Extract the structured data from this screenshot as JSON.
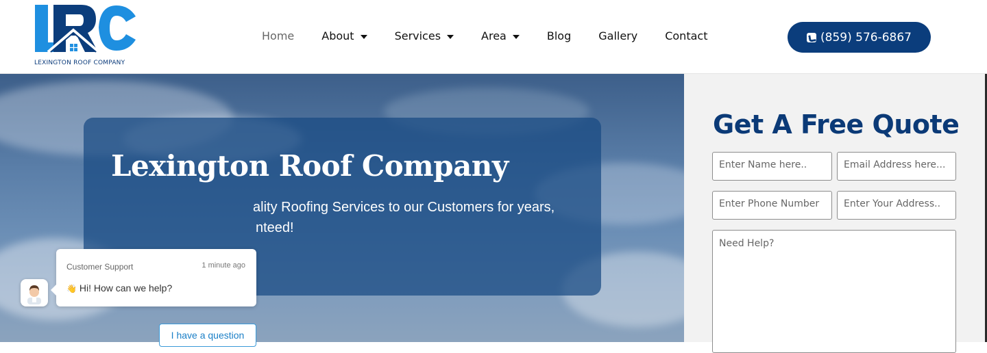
{
  "header": {
    "logo_letters": "LRC",
    "logo_tagline": "LEXINGTON ROOF COMPANY",
    "phone": "(859) 576-6867"
  },
  "nav": {
    "items": [
      {
        "label": "Home",
        "active": true,
        "dropdown": false
      },
      {
        "label": "About",
        "active": false,
        "dropdown": true
      },
      {
        "label": "Services",
        "active": false,
        "dropdown": true
      },
      {
        "label": "Area",
        "active": false,
        "dropdown": true
      },
      {
        "label": "Blog",
        "active": false,
        "dropdown": false
      },
      {
        "label": "Gallery",
        "active": false,
        "dropdown": false
      },
      {
        "label": "Contact",
        "active": false,
        "dropdown": false
      }
    ]
  },
  "hero": {
    "title": "Lexington Roof Company",
    "subtitle": "ality Roofing Services to our Customers for years,",
    "subtitle_line2": "nteed!"
  },
  "quote_form": {
    "title": "Get A Free Quote",
    "name_placeholder": "Enter Name here..",
    "email_placeholder": "Email Address here...",
    "phone_placeholder": "Enter Phone Number",
    "address_placeholder": "Enter Your Address..",
    "message_placeholder": "Need Help?"
  },
  "chat": {
    "agent": "Customer Support",
    "time": "1 minute ago",
    "emoji": "👋",
    "message": "Hi! How can we help?",
    "button": "I have a question"
  },
  "colors": {
    "brand_navy": "#0b3d7c",
    "brand_blue": "#1e8fe0",
    "quote_title": "#0b3a77"
  }
}
